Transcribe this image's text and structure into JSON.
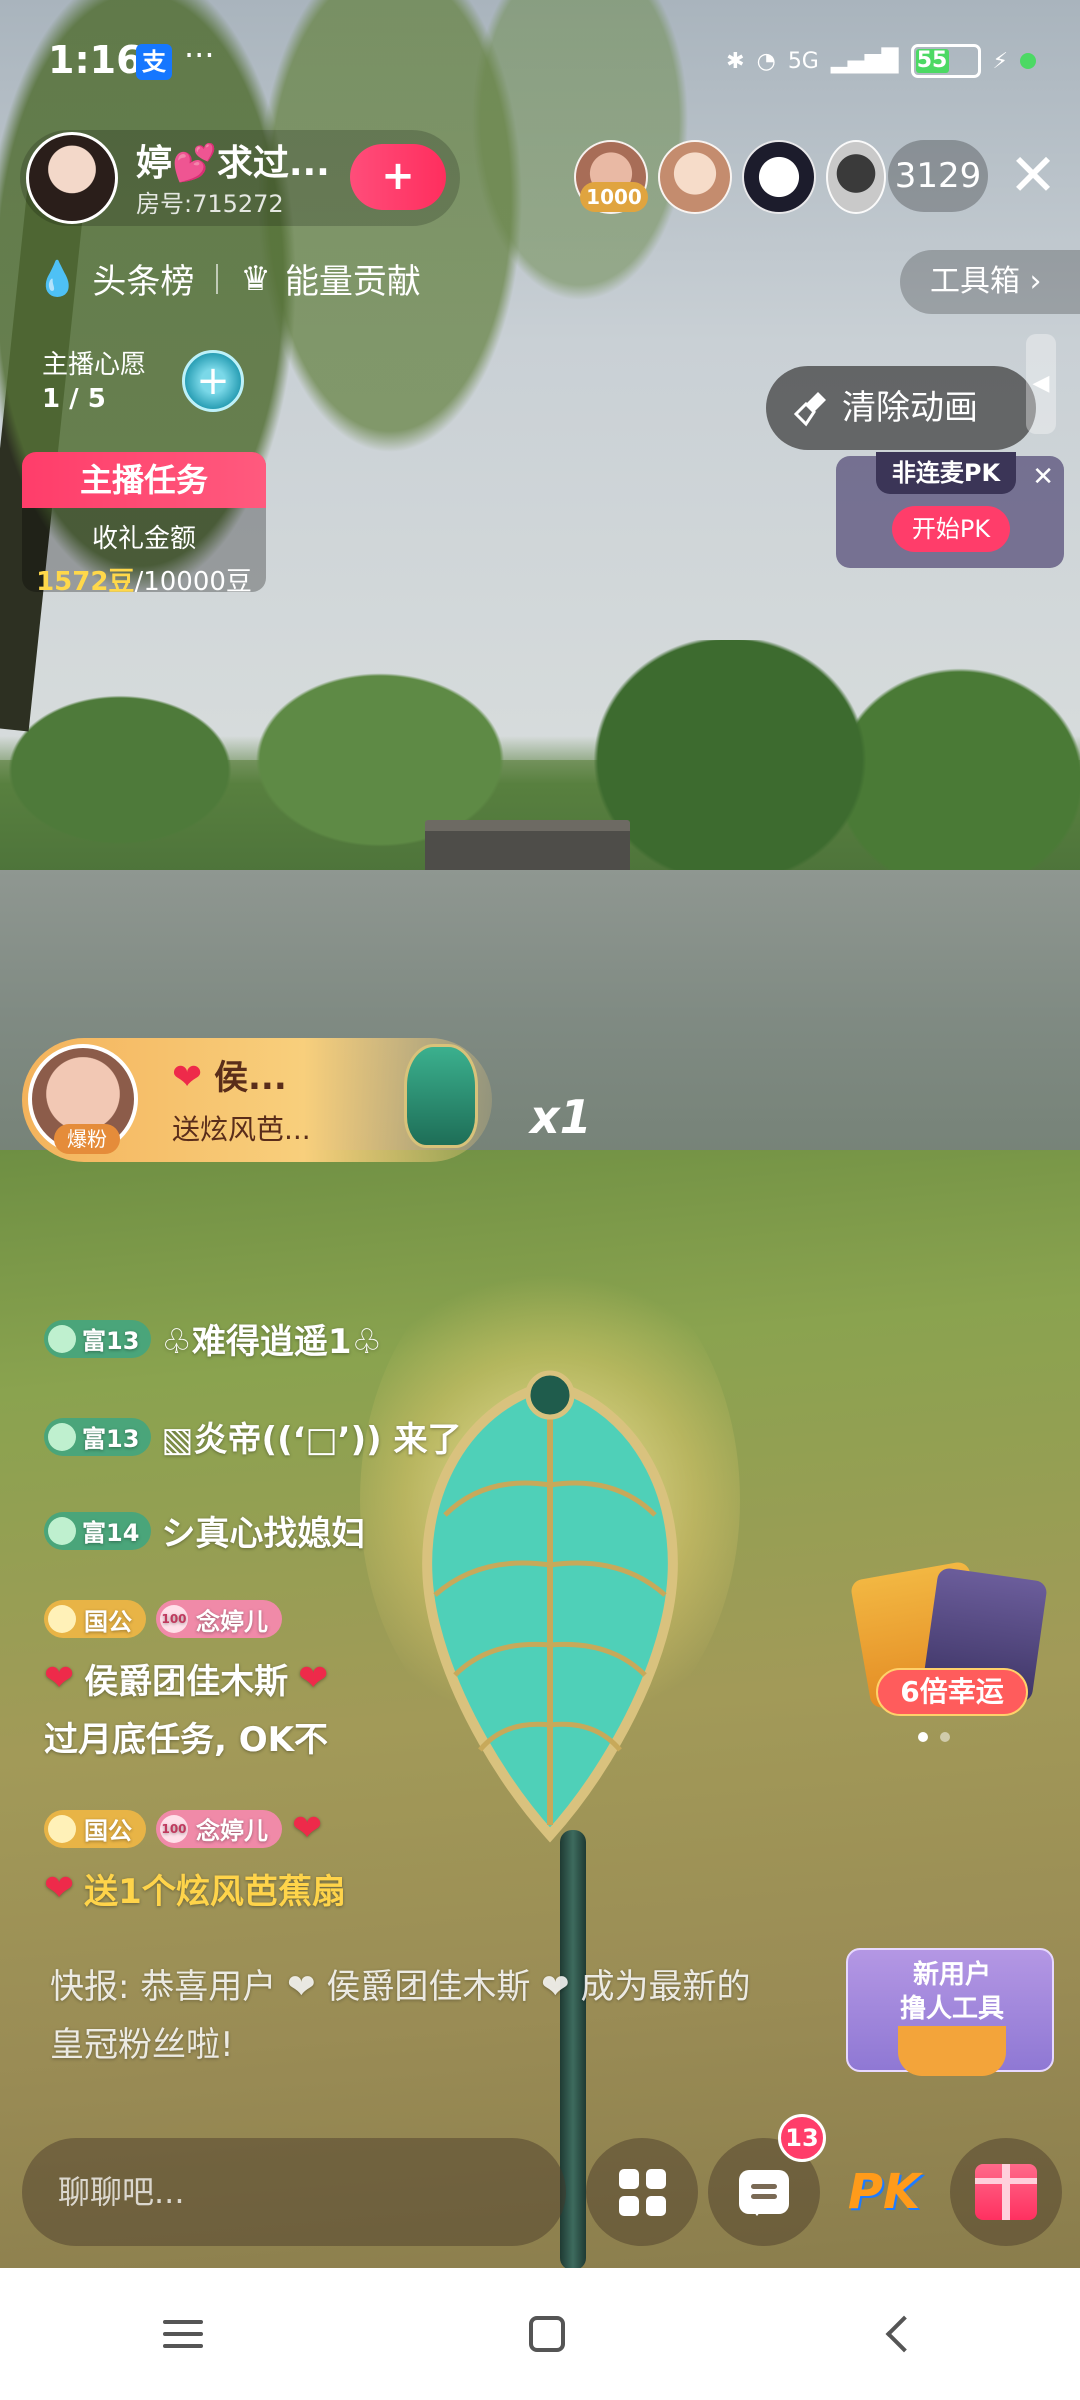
{
  "status_bar": {
    "time": "1:16",
    "app_badge": "支",
    "more": "···",
    "network": "5G",
    "battery": "55"
  },
  "anchor": {
    "name": "婷💕求过...",
    "room_id": "房号:715272",
    "follow_label": "+"
  },
  "viewers": {
    "first_badge": "1000",
    "count": "3129"
  },
  "ranks": {
    "headline": "头条榜",
    "energy": "能量贡献"
  },
  "toolbox_label": "工具箱",
  "wish": {
    "label": "主播心愿",
    "progress": "1 / 5"
  },
  "task": {
    "title": "主播任务",
    "subtitle": "收礼金额",
    "current": "1572豆",
    "target": "/10000豆"
  },
  "clear_anim_label": "清除动画",
  "pk_card": {
    "title": "非连麦PK",
    "start": "开始PK"
  },
  "gift_banner": {
    "user": "侯...",
    "desc": "送炫风芭...",
    "fan_badge": "爆粉",
    "multiplier": "x1"
  },
  "chat": [
    {
      "badge": "富13",
      "text": "♧难得逍遥1♧"
    },
    {
      "badge": "富13",
      "text": "▧炎帝((ʻ□ʼ)) 来了"
    },
    {
      "badge": "富14",
      "text": "シ真心找媳妇"
    }
  ],
  "chat_gift_1": {
    "noble": "国公",
    "fan": "念婷儿",
    "fan_level": "100",
    "user": "侯爵团佳木斯",
    "message": "过月底任务, OK不"
  },
  "chat_gift_2": {
    "noble": "国公",
    "fan": "念婷儿",
    "fan_level": "100",
    "message": "送1个炫风芭蕉扇"
  },
  "news": "快报: 恭喜用户 ❤ 侯爵团佳木斯 ❤ 成为最新的皇冠粉丝啦!",
  "luck_label": "6倍幸运",
  "new_user": {
    "line1": "新用户",
    "line2": "撸人工具"
  },
  "input_placeholder": "聊聊吧...",
  "unread_count": "13",
  "pk_button": "PK",
  "colors": {
    "accent_pink": "#ff3d6a",
    "gold": "#ffd84a",
    "badge_green": "#4aa57a"
  }
}
